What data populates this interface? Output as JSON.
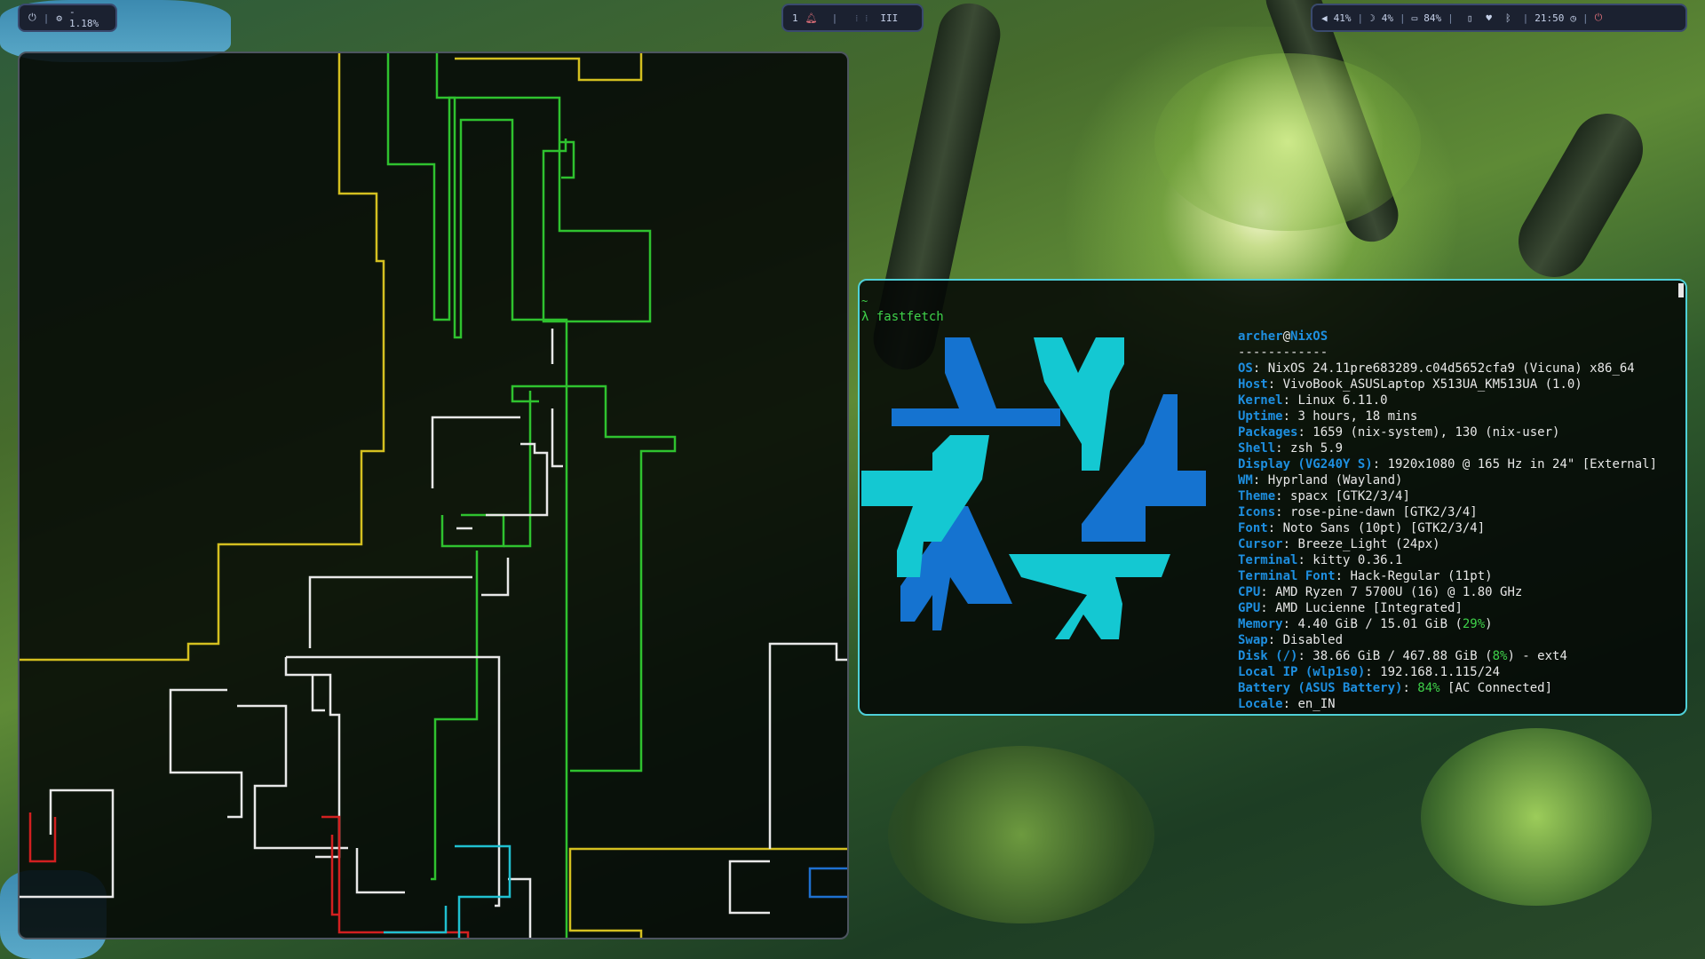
{
  "colors": {
    "bar_bg": "#1b2130",
    "bar_border": "#3a4a6e",
    "active_border": "#4fd0d8",
    "inactive_border": "#4d5560",
    "key": "#1e8fe0",
    "green": "#3fd24a",
    "logo_light": "#14c8d2",
    "logo_dark": "#1573d0"
  },
  "topbar": {
    "left": {
      "power_icon": "power-icon",
      "cpu_icon": "cpu-icon",
      "cpu_text": "- 1.18%"
    },
    "center": {
      "workspace_label": "1",
      "notification_icon": "bell-icon",
      "workspace_numeral": "III"
    },
    "right": {
      "volume_icon": "volume-icon",
      "volume_text": "41%",
      "brightness_icon": "moon-icon",
      "brightness_text": "4%",
      "battery_icon": "battery-icon",
      "battery_text": "84%",
      "phone_icon": "phone-icon",
      "wifi_icon": "wifi-icon",
      "bluetooth_icon": "bluetooth-icon",
      "clock_text": "21:50",
      "clock_icon": "clock-icon",
      "power_icon": "power-icon"
    }
  },
  "terminal": {
    "tilde": "~",
    "prompt_symbol": "λ",
    "command": "fastfetch",
    "user": "archer",
    "at": "@",
    "host": "NixOS",
    "separator": "------------",
    "info": [
      {
        "key": "OS",
        "value": "NixOS 24.11pre683289.c04d5652cfa9 (Vicuna) x86_64"
      },
      {
        "key": "Host",
        "value": "VivoBook_ASUSLaptop X513UA_KM513UA (1.0)"
      },
      {
        "key": "Kernel",
        "value": "Linux 6.11.0"
      },
      {
        "key": "Uptime",
        "value": "3 hours, 18 mins"
      },
      {
        "key": "Packages",
        "value": "1659 (nix-system), 130 (nix-user)"
      },
      {
        "key": "Shell",
        "value": "zsh 5.9"
      },
      {
        "key": "Display (VG240Y S)",
        "value": "1920x1080 @ 165 Hz in 24\" [External]"
      },
      {
        "key": "WM",
        "value": "Hyprland (Wayland)"
      },
      {
        "key": "Theme",
        "value": "spacx [GTK2/3/4]"
      },
      {
        "key": "Icons",
        "value": "rose-pine-dawn [GTK2/3/4]"
      },
      {
        "key": "Font",
        "value": "Noto Sans (10pt) [GTK2/3/4]"
      },
      {
        "key": "Cursor",
        "value": "Breeze_Light (24px)"
      },
      {
        "key": "Terminal",
        "value": "kitty 0.36.1"
      },
      {
        "key": "Terminal Font",
        "value": "Hack-Regular (11pt)"
      },
      {
        "key": "CPU",
        "value": "AMD Ryzen 7 5700U (16) @ 1.80 GHz"
      },
      {
        "key": "GPU",
        "value": "AMD Lucienne [Integrated]"
      },
      {
        "key": "Memory",
        "value": "4.40 GiB / 15.01 GiB (",
        "green": "29%",
        "tail": ")"
      },
      {
        "key": "Swap",
        "value": "Disabled"
      },
      {
        "key": "Disk (/)",
        "value": "38.66 GiB / 467.88 GiB (",
        "green": "8%",
        "tail": ") - ext4"
      },
      {
        "key": "Local IP (wlp1s0)",
        "value": "192.168.1.115/24"
      },
      {
        "key": "Battery (ASUS Battery)",
        "value": "",
        "green": "84%",
        "tail": " [AC Connected]"
      },
      {
        "key": "Locale",
        "value": "en_IN"
      }
    ]
  }
}
